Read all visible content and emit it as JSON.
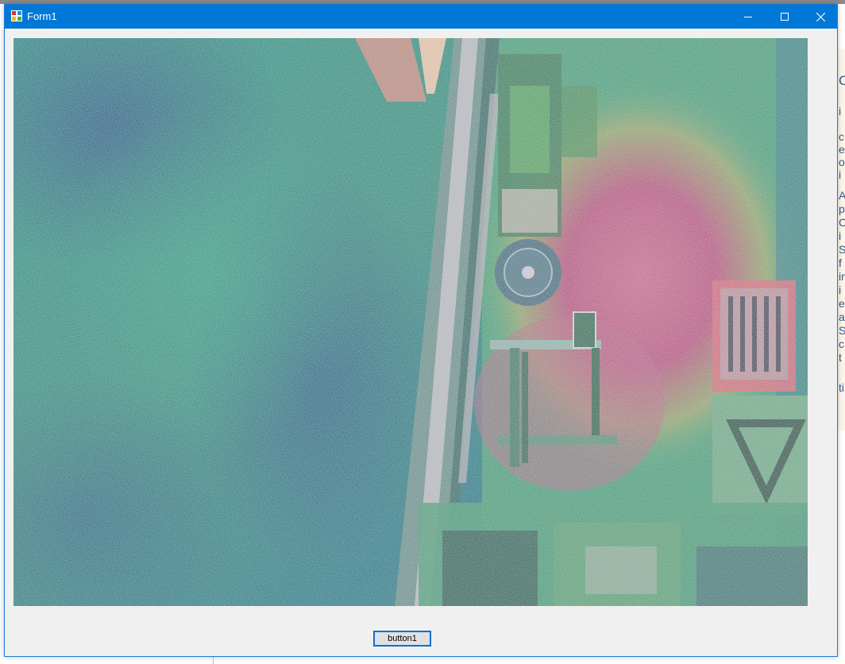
{
  "window": {
    "title": "Form1",
    "icon": "winforms-app-icon",
    "controls": {
      "minimize_icon": "minimize-icon",
      "maximize_icon": "maximize-icon",
      "close_icon": "close-icon"
    },
    "accent_color": "#0078d7"
  },
  "form": {
    "picture_box": {
      "content": "noisy-false-color-camera-image"
    },
    "button1_label": "button1"
  },
  "background_app": {
    "right_panel_fragments": [
      "C",
      "i",
      "c",
      "e",
      "o",
      "i",
      "A",
      "p",
      "C",
      "i",
      "S",
      "f",
      "in",
      "i",
      "e",
      "a",
      "S",
      "c",
      "t",
      "ti"
    ]
  }
}
